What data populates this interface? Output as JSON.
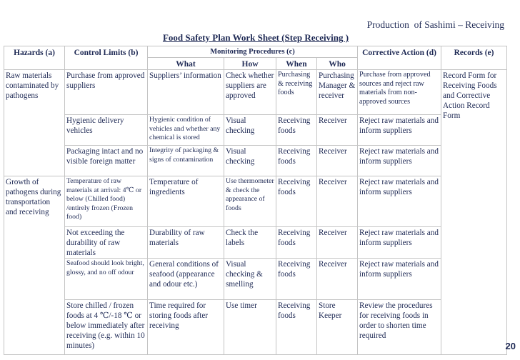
{
  "slide_title": "Production  of Sashimi – Receiving",
  "sheet_title": "Food Safety Plan Work Sheet (Step Receiving )",
  "headers": {
    "hazards": "Hazards (a)",
    "control_limits": "Control Limits (b)",
    "monitoring": "Monitoring Procedures (c)",
    "what": "What",
    "how": "How",
    "when": "When",
    "who": "Who",
    "corrective_action": "Corrective Action (d)",
    "records": "Records (e)"
  },
  "hazards": [
    "Raw materials contaminated by pathogens",
    "Growth of pathogens during transportation and receiving"
  ],
  "records": "Record Form for Receiving Foods and Corrective Action Record Form",
  "rows": [
    {
      "control": "Purchase from approved suppliers",
      "what": "Suppliers’ information",
      "how": "Check whether suppliers are approved",
      "when": "Purchasing & receiving foods",
      "who": "Purchasing Manager & receiver",
      "corrective": "Purchase from approved sources and reject raw materials from non-approved sources"
    },
    {
      "control": "Hygienic delivery vehicles",
      "what": "Hygienic condition of vehicles and whether any chemical is stored",
      "how": "Visual checking",
      "when": "Receiving foods",
      "who": "Receiver",
      "corrective": "Reject raw materials and inform suppliers"
    },
    {
      "control": "Packaging intact and no visible foreign matter",
      "what": "Integrity of packaging & signs of contamination",
      "how": "Visual checking",
      "when": "Receiving foods",
      "who": "Receiver",
      "corrective": "Reject raw materials and inform suppliers"
    },
    {
      "control": "Temperature of raw materials at arrival: 4℃ or below (Chilled food) /entirely frozen (Frozen food)",
      "what": "Temperature of ingredients",
      "how": "Use thermometer & check the appearance of foods",
      "when": "Receiving foods",
      "who": "Receiver",
      "corrective": "Reject raw materials and inform suppliers"
    },
    {
      "control": "Not exceeding the durability of raw materials",
      "what": "Durability of raw materials",
      "how": "Check the labels",
      "when": "Receiving foods",
      "who": "Receiver",
      "corrective": "Reject raw materials and inform suppliers"
    },
    {
      "control": "Seafood should look bright, glossy, and no off odour",
      "what": "General conditions of seafood (appearance and odour etc.)",
      "how": "Visual checking & smelling",
      "when": "Receiving foods",
      "who": "Receiver",
      "corrective": "Reject raw materials and inform suppliers"
    },
    {
      "control": "Store chilled / frozen foods at 4 ℃/-18 ℃ or below immediately after receiving (e.g. within 10 minutes)",
      "what": "Time required for storing foods after receiving",
      "how": "Use timer",
      "when": "Receiving foods",
      "who": "Store Keeper",
      "corrective": "Review the procedures for receiving foods in order to shorten time required"
    }
  ],
  "page_number": "20"
}
